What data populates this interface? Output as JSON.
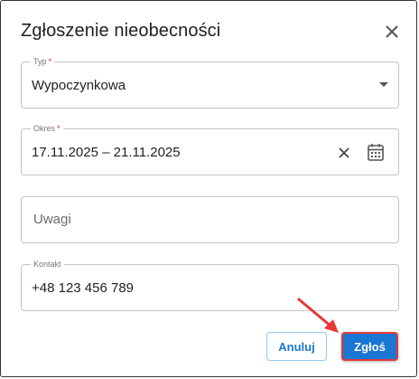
{
  "dialog": {
    "title": "Zgłoszenie nieobecności"
  },
  "fields": {
    "type": {
      "label": "Typ",
      "required_mark": "*",
      "value": "Wypoczynkowa"
    },
    "period": {
      "label": "Okres",
      "required_mark": "*",
      "value": "17.11.2025 – 21.11.2025"
    },
    "notes": {
      "placeholder": "Uwagi"
    },
    "contact": {
      "label": "Kontakt",
      "value": "+48 123 456 789"
    }
  },
  "actions": {
    "cancel_label": "Anuluj",
    "submit_label": "Zgłoś"
  },
  "icons": {
    "close": "close-icon",
    "dropdown": "chevron-down-icon",
    "clear": "clear-icon",
    "calendar": "calendar-icon",
    "annotation": "arrow-icon"
  },
  "colors": {
    "accent": "#1976d2",
    "required": "#d32f2f",
    "highlight": "#e53935"
  }
}
